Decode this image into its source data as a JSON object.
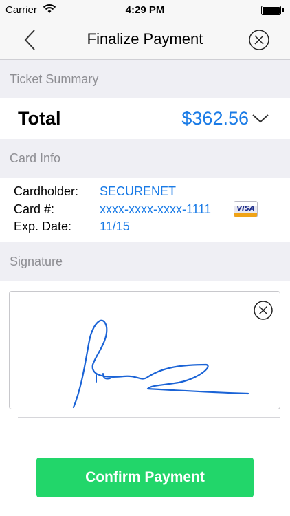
{
  "status": {
    "carrier": "Carrier",
    "time": "4:29 PM"
  },
  "nav": {
    "title": "Finalize Payment"
  },
  "sections": {
    "ticket_summary": "Ticket Summary",
    "card_info": "Card Info",
    "signature": "Signature"
  },
  "total": {
    "label": "Total",
    "amount": "$362.56"
  },
  "card": {
    "cardholder_label": "Cardholder:",
    "cardholder_value": "SECURENET",
    "number_label": "Card #:",
    "number_value": "xxxx-xxxx-xxxx-1111",
    "exp_label": "Exp. Date:",
    "exp_value": "11/15",
    "brand": "VISA"
  },
  "confirm_button": {
    "label": "Confirm Payment"
  },
  "colors": {
    "accent": "#1a7be6",
    "confirm": "#22d66a",
    "section_bg": "#efeff4"
  }
}
